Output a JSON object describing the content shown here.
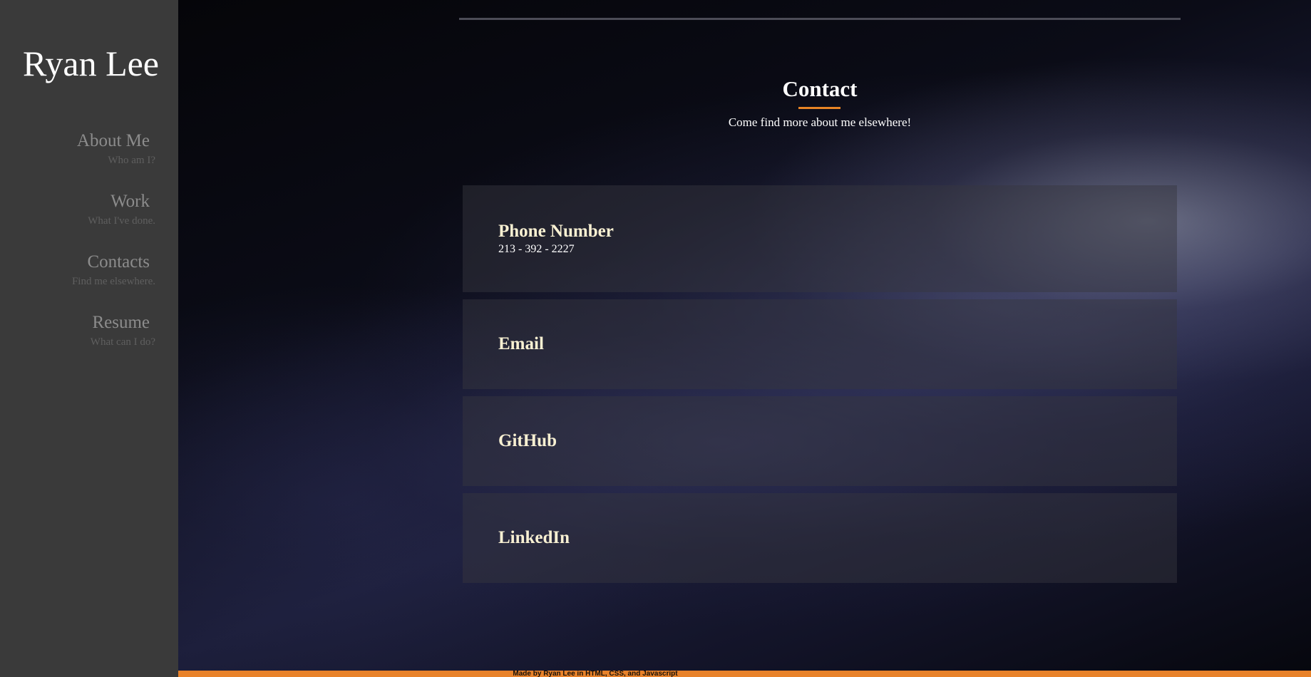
{
  "sidebar": {
    "brand": "Ryan Lee",
    "items": [
      {
        "label": "About Me",
        "sub": "Who am I?"
      },
      {
        "label": "Work",
        "sub": "What I've done."
      },
      {
        "label": "Contacts",
        "sub": "Find me elsewhere."
      },
      {
        "label": "Resume",
        "sub": "What can I do?"
      }
    ]
  },
  "main": {
    "title": "Contact",
    "subtitle": "Come find more about me elsewhere!",
    "cards": [
      {
        "title": "Phone Number",
        "detail": "213 - 392 - 2227"
      },
      {
        "title": "Email"
      },
      {
        "title": "GitHub"
      },
      {
        "title": "LinkedIn"
      }
    ]
  },
  "footer": {
    "text": "Made by Ryan Lee in HTML, CSS, and Javascript"
  },
  "colors": {
    "sidebar_bg": "#3a3a3a",
    "accent": "#e88425",
    "card_title": "#f8f0d2",
    "nav_label": "#8c8c8c",
    "nav_sub": "#5f5f5f"
  }
}
